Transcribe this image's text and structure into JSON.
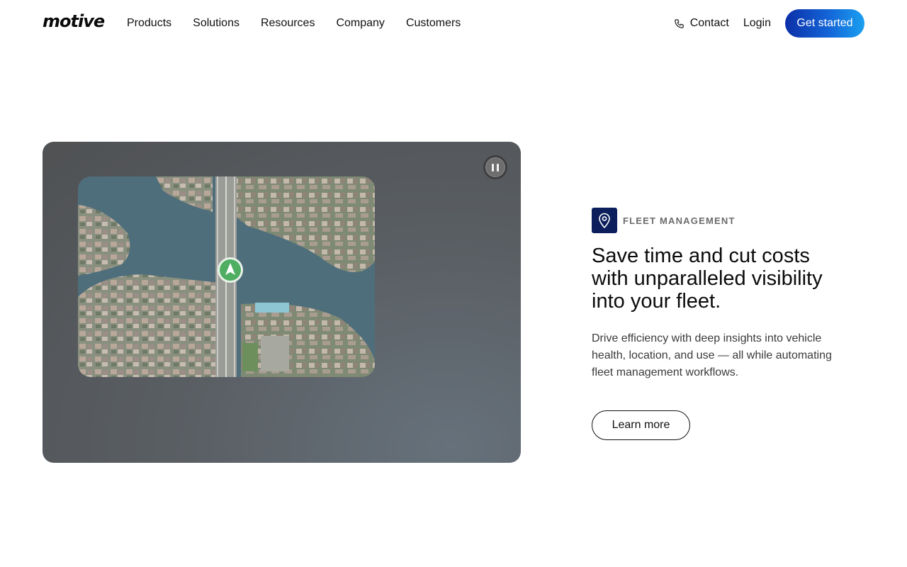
{
  "header": {
    "logo": "motive",
    "nav": [
      "Products",
      "Solutions",
      "Resources",
      "Company",
      "Customers"
    ],
    "contact_label": "Contact",
    "login_label": "Login",
    "cta_label": "Get started"
  },
  "feature": {
    "eyebrow": "FLEET MANAGEMENT",
    "headline": "Save time and cut costs with unparalleled visibility into your fleet.",
    "body": "Drive efficiency with deep insights into vehicle health, location, and use — all while automating fleet management workflows.",
    "button_label": "Learn more"
  },
  "icons": {
    "phone": "phone-icon",
    "pause": "pause-icon",
    "location": "location-pin-icon",
    "vehicle": "navigation-arrow-icon"
  },
  "colors": {
    "accent_start": "#0b2fa8",
    "accent_end": "#1aa0f0",
    "eyebrow_icon_bg": "#0c1f5c"
  }
}
